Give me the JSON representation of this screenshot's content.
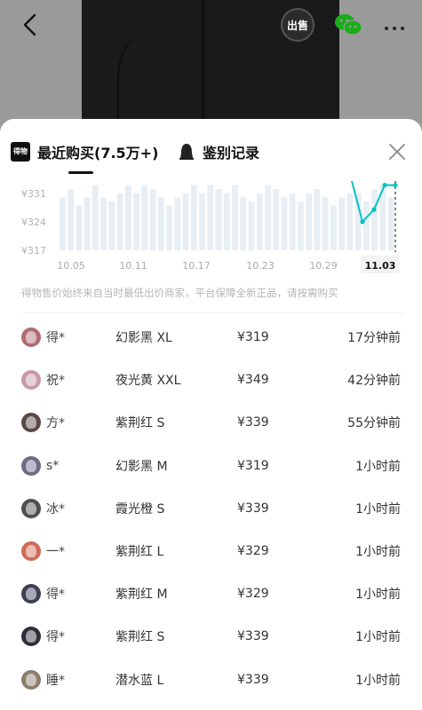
{
  "header": {
    "sell_badge": "出售",
    "icons": {
      "back": "chevron-left-icon",
      "wechat": "wechat-icon",
      "more": "more-dots-icon"
    }
  },
  "sheet": {
    "tabs": [
      {
        "label": "最近购买(7.5万+)",
        "logo": "得物",
        "active": true
      },
      {
        "label": "鉴别记录",
        "icon": "bell-icon",
        "active": false
      }
    ],
    "close_icon": "close-icon"
  },
  "chart_data": {
    "type": "bar",
    "y_ticks": [
      "¥331",
      "¥324",
      "¥317"
    ],
    "x_ticks": [
      "10.05",
      "10.11",
      "10.17",
      "10.23",
      "10.29",
      "11.03"
    ],
    "highlighted_tick": "11.03",
    "bar_color": "#e7eef4",
    "line_color": "#01c2c3",
    "values": [
      330,
      332,
      328,
      330,
      333,
      330,
      329,
      331,
      333,
      331,
      333,
      332,
      330,
      328,
      330,
      331,
      333,
      331,
      333,
      332,
      331,
      333,
      330,
      329,
      331,
      333,
      332,
      330,
      331,
      329,
      331,
      332,
      330,
      328,
      330,
      331,
      331,
      329,
      332,
      333,
      330
    ],
    "line_points": [
      {
        "x": "10.31",
        "y": 324
      },
      {
        "x": "11.01",
        "y": 327
      },
      {
        "x": "11.02",
        "y": 333
      },
      {
        "x": "11.03",
        "y": 333
      }
    ]
  },
  "notice": "得物售价始终来自当时最低出价商家，平台保障全新正品，请按需购买",
  "purchases": [
    {
      "name": "得*",
      "sku": "幻影黑 XL",
      "price": "¥319",
      "time": "17分钟前",
      "avatar_color": "#b06c74"
    },
    {
      "name": "祝*",
      "sku": "夜光黄 XXL",
      "price": "¥349",
      "time": "42分钟前",
      "avatar_color": "#c89aa8"
    },
    {
      "name": "方*",
      "sku": "紫荆红 S",
      "price": "¥339",
      "time": "55分钟前",
      "avatar_color": "#5b4a44"
    },
    {
      "name": "s*",
      "sku": "幻影黑 M",
      "price": "¥319",
      "time": "1小时前",
      "avatar_color": "#6f6a85"
    },
    {
      "name": "冰*",
      "sku": "霞光橙 S",
      "price": "¥339",
      "time": "1小时前",
      "avatar_color": "#4f4f4f"
    },
    {
      "name": "一*",
      "sku": "紫荆红 L",
      "price": "¥329",
      "time": "1小时前",
      "avatar_color": "#d06a58"
    },
    {
      "name": "得*",
      "sku": "紫荆红 M",
      "price": "¥329",
      "time": "1小时前",
      "avatar_color": "#3e3e55"
    },
    {
      "name": "得*",
      "sku": "紫荆红 S",
      "price": "¥339",
      "time": "1小时前",
      "avatar_color": "#2e2e3a"
    },
    {
      "name": "睡*",
      "sku": "潜水蓝 L",
      "price": "¥339",
      "time": "1小时前",
      "avatar_color": "#8d7d6c"
    }
  ]
}
